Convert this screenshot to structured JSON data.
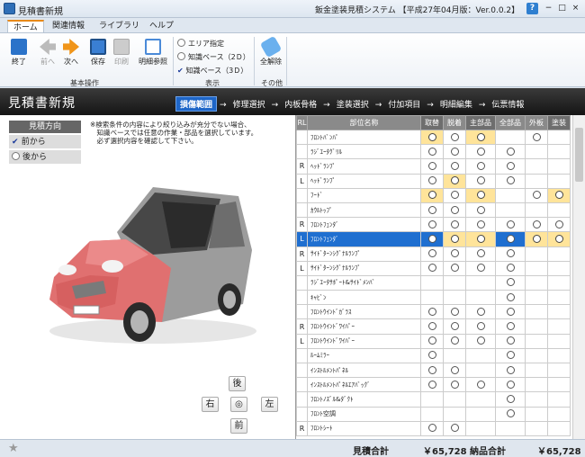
{
  "window": {
    "title": "見積書新規",
    "system_title": "鈑金塗装見積システム 【平成27年04月版：Ver.0.0.2】",
    "help": "?",
    "min": "−",
    "max": "□",
    "close": "×"
  },
  "tabs": [
    "ホーム",
    "関連情報",
    "ライブラリ",
    "ヘルプ"
  ],
  "ribbon": {
    "exit": "終了",
    "prev": "前へ",
    "next": "次へ",
    "save": "保存",
    "print": "印刷",
    "detail_ref": "明細参照",
    "group_basic": "基本操作",
    "area": "エリア指定",
    "knowledge2d": "知識ベース（2Ｄ）",
    "knowledge3d": "知識ベース（3Ｄ）",
    "group_view": "表示",
    "delete_all": "全解除",
    "group_other": "その他"
  },
  "header": {
    "title": "見積書新規",
    "steps": [
      "損傷範囲",
      "修理選択",
      "内板骨格",
      "塗装選択",
      "付加項目",
      "明細編集",
      "伝票情報"
    ]
  },
  "direction": {
    "title": "見積方向",
    "front": "前から",
    "back": "後から"
  },
  "notes": [
    "※検索条件の内容により絞り込みが充分でない場合、",
    "　知識ベースでは任意の作業・部品を選択しています。",
    "　必ず選択内容を確認して下さい。"
  ],
  "camera": {
    "back": "後",
    "right": "右",
    "center": "◎",
    "left": "左",
    "front": "前"
  },
  "grid": {
    "headers": [
      "RL",
      "部位名称",
      "取替",
      "脱着",
      "主部品",
      "全部品",
      "外板",
      "塗装"
    ],
    "rows": [
      {
        "rl": "",
        "name": "ﾌﾛﾝﾄﾊﾞﾝﾊﾟ",
        "c": [
          "o",
          "o",
          "o",
          "",
          "o"
        ],
        "orng": [
          1,
          0,
          1,
          0,
          0,
          0
        ]
      },
      {
        "rl": "",
        "name": "ﾗｼﾞｴｰﾀｸﾞﾘﾙ",
        "c": [
          "o",
          "o",
          "o",
          "o",
          "",
          ""
        ],
        "orng": [
          0,
          0,
          0,
          0,
          0,
          0
        ]
      },
      {
        "rl": "R",
        "name": "ﾍｯﾄﾞﾗﾝﾌﾟ",
        "c": [
          "o",
          "o",
          "o",
          "o",
          "",
          ""
        ],
        "orng": [
          0,
          0,
          0,
          0,
          0,
          0
        ]
      },
      {
        "rl": "L",
        "name": "ﾍｯﾄﾞﾗﾝﾌﾟ",
        "c": [
          "o",
          "o",
          "o",
          "o",
          "",
          ""
        ],
        "orng": [
          0,
          1,
          0,
          0,
          0,
          0
        ]
      },
      {
        "rl": "",
        "name": "ﾌｰﾄﾞ",
        "c": [
          "o",
          "o",
          "o",
          "",
          "o",
          "o"
        ],
        "orng": [
          1,
          0,
          1,
          0,
          0,
          1
        ]
      },
      {
        "rl": "",
        "name": "ｶｳﾙﾄｯﾌﾟ",
        "c": [
          "o",
          "o",
          "o",
          "",
          "",
          ""
        ],
        "orng": [
          0,
          0,
          0,
          0,
          0,
          0
        ]
      },
      {
        "rl": "R",
        "name": "ﾌﾛﾝﾄﾌｪﾝﾀﾞ",
        "c": [
          "o",
          "o",
          "o",
          "o",
          "o",
          "o"
        ],
        "orng": [
          0,
          0,
          0,
          0,
          0,
          0
        ]
      },
      {
        "rl": "L",
        "name": "ﾌﾛﾝﾄﾌｪﾝﾀﾞ",
        "c": [
          "o",
          "o",
          "o",
          "o",
          "o",
          "o"
        ],
        "orng": [
          0,
          1,
          1,
          0,
          1,
          1
        ],
        "sel": true
      },
      {
        "rl": "R",
        "name": "ｻｲﾄﾞﾀｰﾝｼｸﾞﾅﾙﾗﾝﾌﾟ",
        "c": [
          "o",
          "o",
          "o",
          "o",
          "",
          ""
        ],
        "orng": [
          0,
          0,
          0,
          0,
          0,
          0
        ]
      },
      {
        "rl": "L",
        "name": "ｻｲﾄﾞﾀｰﾝｼｸﾞﾅﾙﾗﾝﾌﾟ",
        "c": [
          "o",
          "o",
          "o",
          "o",
          "",
          ""
        ],
        "orng": [
          0,
          0,
          0,
          0,
          0,
          0
        ]
      },
      {
        "rl": "",
        "name": "ﾗｼﾞｴｰﾀｻﾎﾟｰﾄ&ｻｲﾄﾞﾒﾝﾊﾞ",
        "c": [
          "",
          "",
          "",
          "o",
          "",
          ""
        ],
        "orng": [
          0,
          0,
          0,
          0,
          0,
          0
        ]
      },
      {
        "rl": "",
        "name": "ｷｬﾋﾞﾝ",
        "c": [
          "",
          "",
          "",
          "o",
          "",
          ""
        ],
        "orng": [
          0,
          0,
          0,
          0,
          0,
          0
        ]
      },
      {
        "rl": "",
        "name": "ﾌﾛﾝﾄｳｲﾝﾄﾞｶﾞﾗｽ",
        "c": [
          "o",
          "o",
          "o",
          "o",
          "",
          ""
        ],
        "orng": [
          0,
          0,
          0,
          0,
          0,
          0
        ]
      },
      {
        "rl": "R",
        "name": "ﾌﾛﾝﾄｳｲﾝﾄﾞﾜｲﾊﾟｰ",
        "c": [
          "o",
          "o",
          "o",
          "o",
          "",
          ""
        ],
        "orng": [
          0,
          0,
          0,
          0,
          0,
          0
        ]
      },
      {
        "rl": "L",
        "name": "ﾌﾛﾝﾄｳｲﾝﾄﾞﾜｲﾊﾟｰ",
        "c": [
          "o",
          "o",
          "o",
          "o",
          "",
          ""
        ],
        "orng": [
          0,
          0,
          0,
          0,
          0,
          0
        ]
      },
      {
        "rl": "",
        "name": "ﾙｰﾑﾐﾗｰ",
        "c": [
          "o",
          "",
          "",
          "o",
          "",
          ""
        ],
        "orng": [
          0,
          0,
          0,
          0,
          0,
          0
        ]
      },
      {
        "rl": "",
        "name": "ｲﾝｽﾄﾙﾒﾝﾄﾊﾟﾈﾙ",
        "c": [
          "o",
          "o",
          "",
          "o",
          "",
          ""
        ],
        "orng": [
          0,
          0,
          0,
          0,
          0,
          0
        ]
      },
      {
        "rl": "",
        "name": "ｲﾝｽﾄﾙﾒﾝﾄﾊﾟﾈﾙｴｱﾊﾞｯｸﾞ",
        "c": [
          "o",
          "o",
          "o",
          "o",
          "",
          ""
        ],
        "orng": [
          0,
          0,
          0,
          0,
          0,
          0
        ]
      },
      {
        "rl": "",
        "name": "ﾌﾛﾝﾄﾉｽﾞﾙ&ﾀﾞｸﾄ",
        "c": [
          "",
          "",
          "",
          "o",
          "",
          ""
        ],
        "orng": [
          0,
          0,
          0,
          0,
          0,
          0
        ]
      },
      {
        "rl": "",
        "name": "ﾌﾛﾝﾄ空調",
        "c": [
          "",
          "",
          "",
          "o",
          "",
          ""
        ],
        "orng": [
          0,
          0,
          0,
          0,
          0,
          0
        ]
      },
      {
        "rl": "R",
        "name": "ﾌﾛﾝﾄｼｰﾄ",
        "c": [
          "o",
          "o",
          "",
          "",
          "",
          ""
        ],
        "orng": [
          0,
          0,
          0,
          0,
          0,
          0
        ]
      }
    ]
  },
  "status": {
    "estimate_label": "見積合計",
    "estimate_value": "￥65,728",
    "delivery_label": "納品合計",
    "delivery_value": "￥65,728"
  }
}
